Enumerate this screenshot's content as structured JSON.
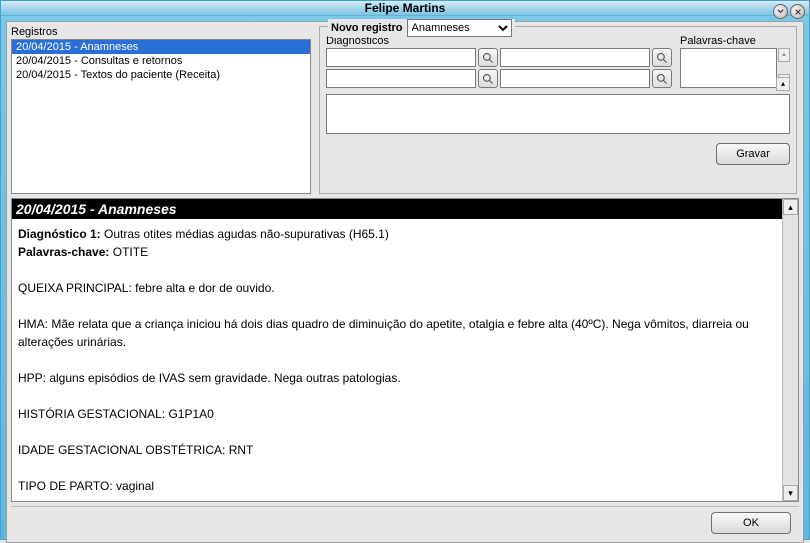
{
  "window": {
    "title": "Felipe Martins"
  },
  "registros": {
    "label": "Registros",
    "items": [
      {
        "label": "20/04/2015 - Anamneses",
        "selected": true
      },
      {
        "label": "20/04/2015 - Consultas e retornos",
        "selected": false
      },
      {
        "label": "20/04/2015 - Textos do paciente (Receita)",
        "selected": false
      }
    ]
  },
  "novo_registro": {
    "legend": "Novo registro",
    "selected_type": "Anamneses",
    "diagnosticos_label": "Diagnósticos",
    "palavras_label": "Palavras-chave",
    "gravar_label": "Gravar"
  },
  "record": {
    "header": "20/04/2015 - Anamneses",
    "diag_label": "Diagnóstico 1:",
    "diag_value": "Outras otites médias agudas não-supurativas (H65.1)",
    "palavras_label": "Palavras-chave:",
    "palavras_value": "OTITE",
    "lines": [
      "QUEIXA PRINCIPAL: febre alta e dor de ouvido.",
      "HMA: Mãe relata que a criança iniciou há dois dias quadro de diminuição do apetite, otalgia e  febre alta (40ºC). Nega vômitos, diarreia ou alterações urinárias.",
      "HPP: alguns episódios de IVAS sem gravidade. Nega outras patologias.",
      "HISTÓRIA GESTACIONAL: G1P1A0",
      "IDADE GESTACIONAL OBSTÉTRICA: RNT",
      "TIPO DE PARTO: vaginal"
    ]
  },
  "footer": {
    "ok_label": "OK"
  }
}
